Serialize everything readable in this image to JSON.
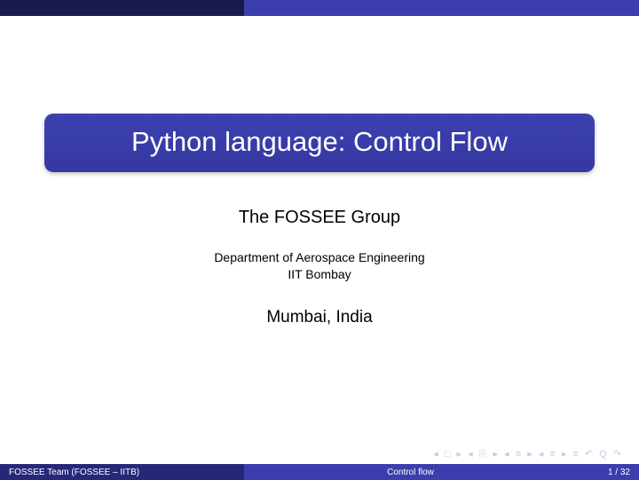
{
  "slide": {
    "title": "Python language: Control Flow",
    "author": "The FOSSEE Group",
    "department": "Department of Aerospace Engineering",
    "institution": "IIT Bombay",
    "location": "Mumbai, India"
  },
  "footer": {
    "author_short": "FOSSEE Team  (FOSSEE – IITB)",
    "title_short": "Control flow",
    "page": "1 / 32"
  },
  "nav": {
    "symbols": "◂ □ ▸  ◂ ⎘ ▸  ◂ ≡ ▸  ◂ ≡ ▸   ≡   ↶ Q ↷"
  }
}
